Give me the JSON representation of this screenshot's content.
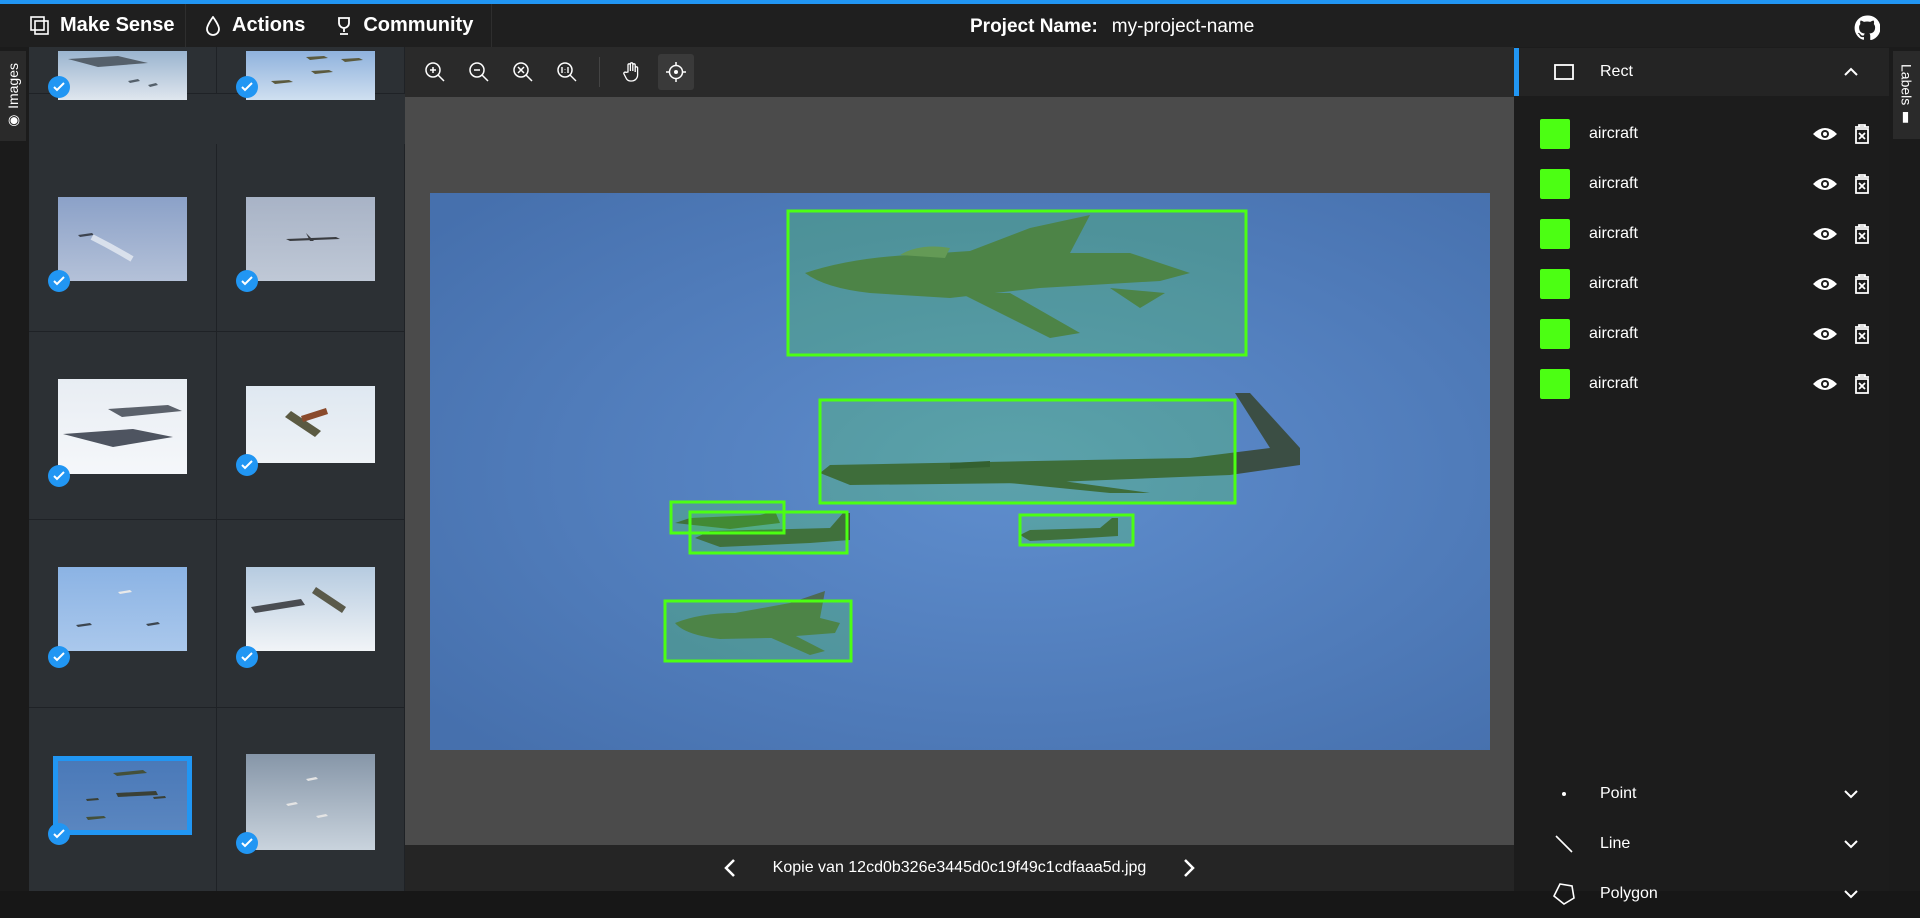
{
  "topbar": {
    "app_name": "Make Sense",
    "nav": [
      {
        "label": "Actions"
      },
      {
        "label": "Community"
      }
    ],
    "project_label": "Project Name:",
    "project_name": "my-project-name"
  },
  "left_tab": {
    "label": "Images"
  },
  "right_tab": {
    "label": "Labels"
  },
  "footer": {
    "filename": "Kopie van 12cd0b326e3445d0c19f49c1cdfaaa5d.jpg"
  },
  "label_types": {
    "rect": "Rect",
    "point": "Point",
    "line": "Line",
    "polygon": "Polygon"
  },
  "labels": [
    {
      "name": "aircraft",
      "color": "#4cff13"
    },
    {
      "name": "aircraft",
      "color": "#4cff13"
    },
    {
      "name": "aircraft",
      "color": "#4cff13"
    },
    {
      "name": "aircraft",
      "color": "#4cff13"
    },
    {
      "name": "aircraft",
      "color": "#4cff13"
    },
    {
      "name": "aircraft",
      "color": "#4cff13"
    }
  ],
  "colors": {
    "accent": "#2196f3",
    "label": "#4cff13",
    "sky": "#4a79b8"
  },
  "toolbar_icons": [
    "zoom-in-icon",
    "zoom-out-icon",
    "zoom-fit-icon",
    "zoom-actual-icon",
    "pan-hand-icon",
    "crosshair-icon"
  ]
}
